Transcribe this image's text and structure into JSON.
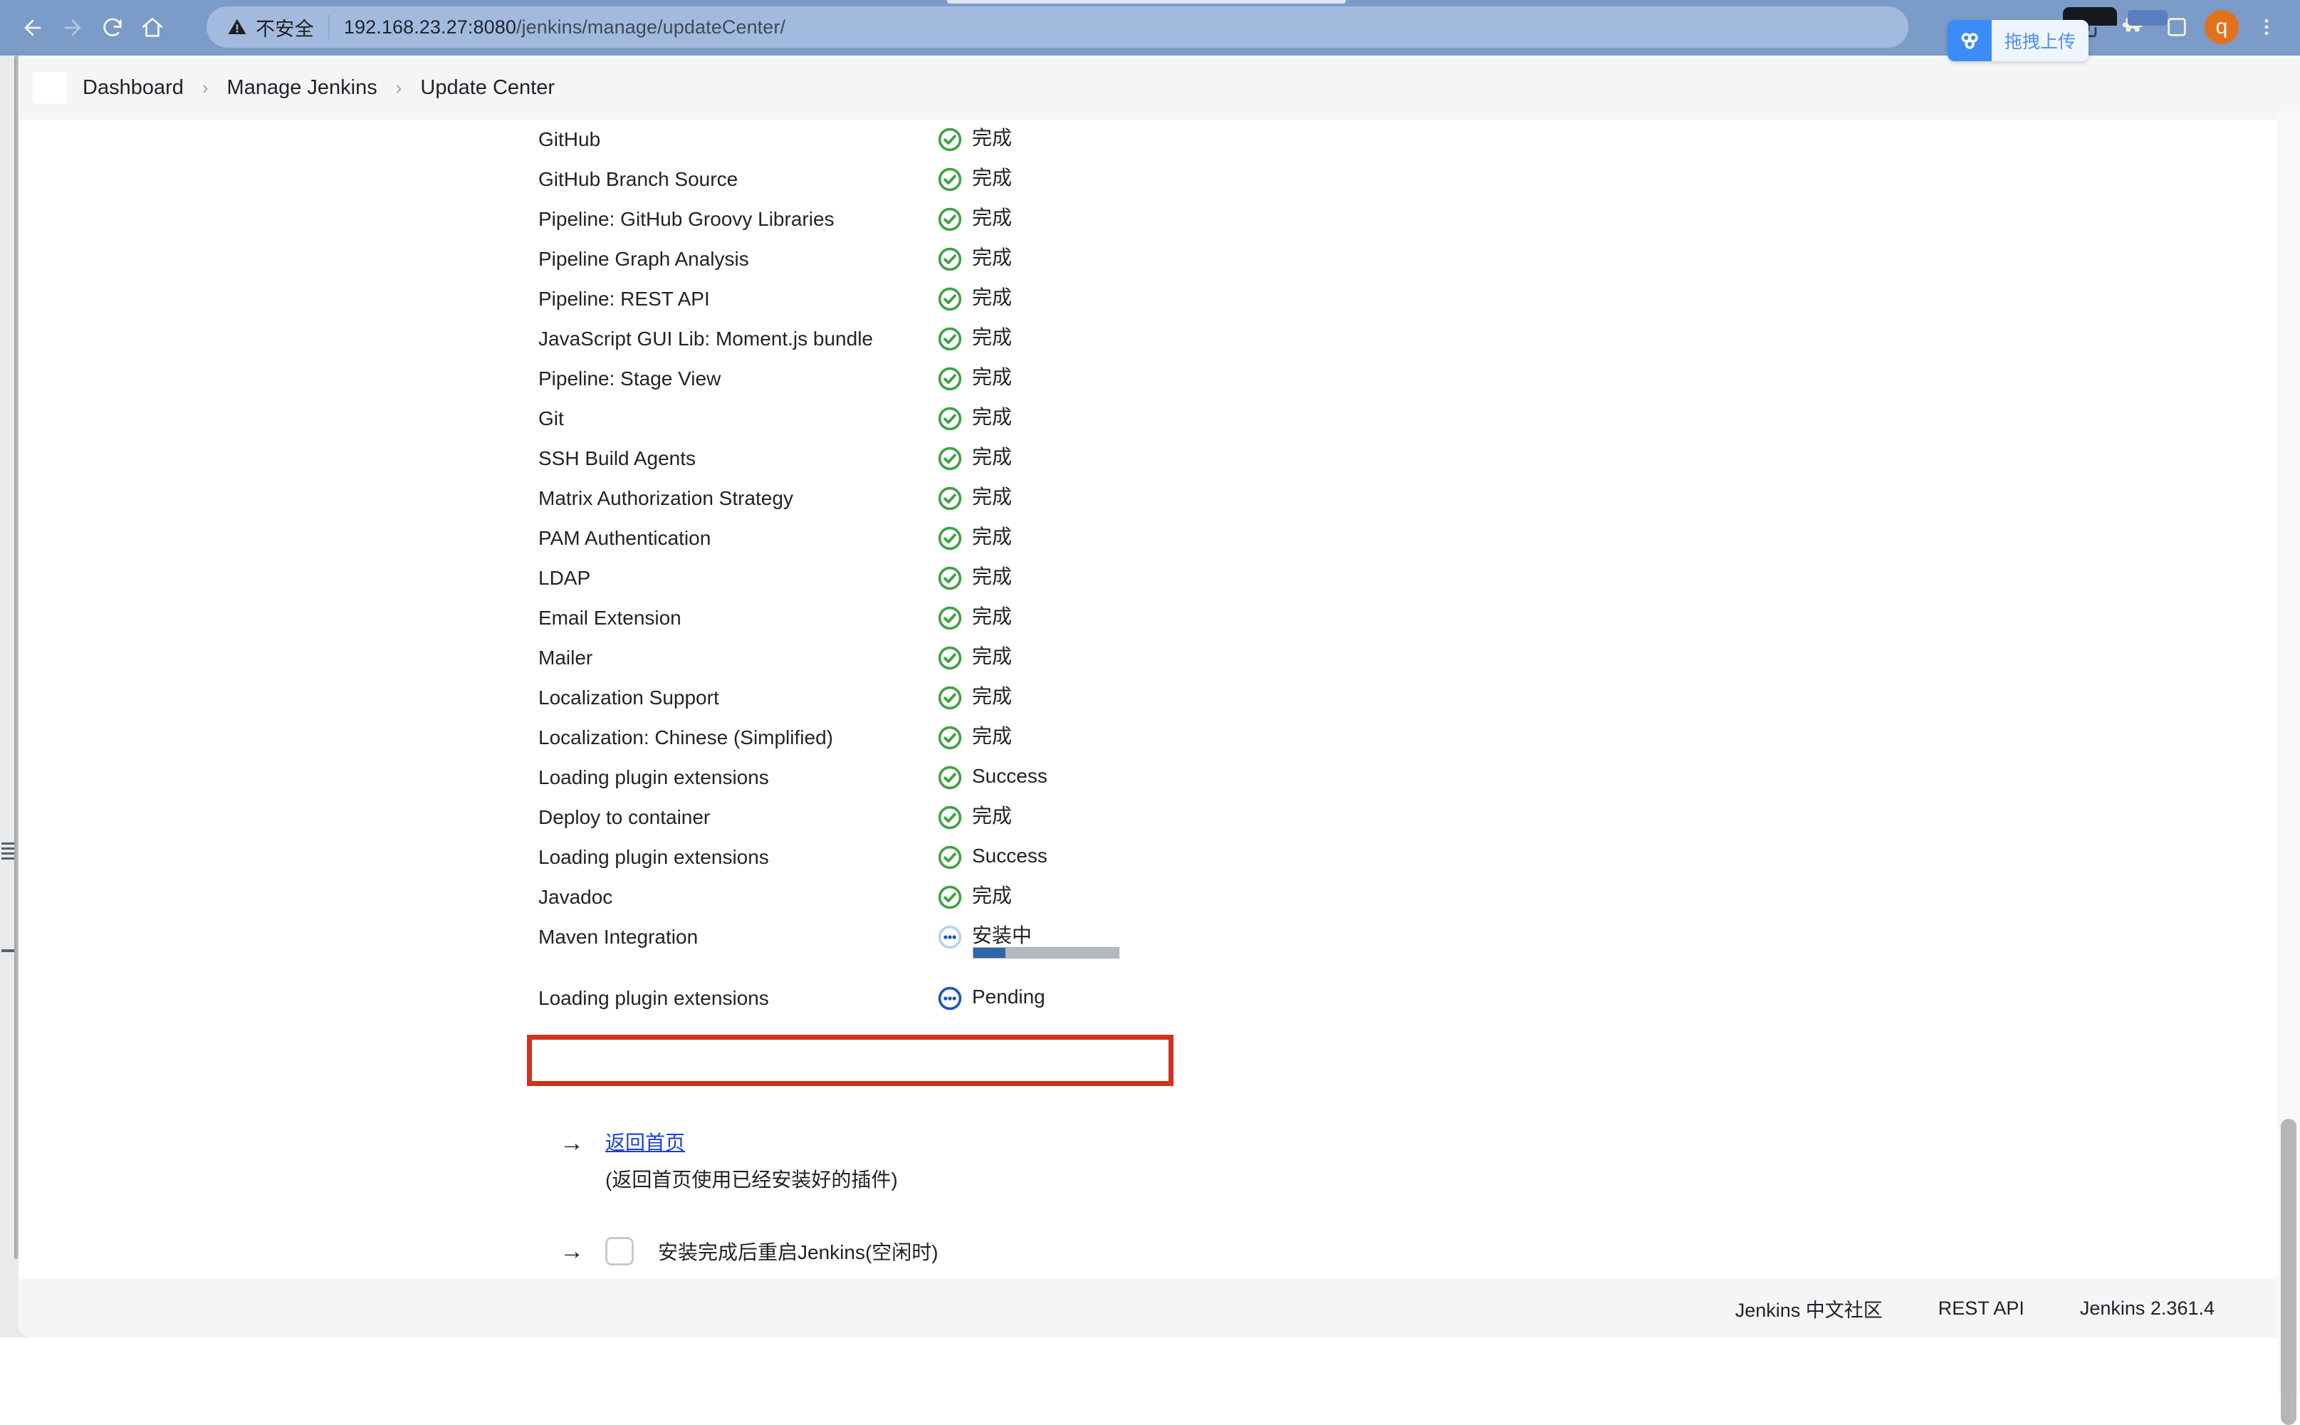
{
  "browser": {
    "nav": {
      "back": "back-arrow",
      "forward": "forward-arrow",
      "reload": "reload",
      "home": "home"
    },
    "omnibox": {
      "security_label": "不安全",
      "url_host": "192.168.23.27:8080",
      "url_path": "/jenkins/manage/updateCenter/"
    },
    "upload_bubble": {
      "label": "拖拽上传"
    },
    "avatar_initial": "q"
  },
  "breadcrumb": {
    "separator": "›",
    "items": [
      {
        "label": "Dashboard"
      },
      {
        "label": "Manage Jenkins"
      },
      {
        "label": "Update Center"
      }
    ]
  },
  "plugin_list": {
    "status_text": {
      "done": "完成",
      "success": "Success",
      "installing": "安装中",
      "pending": "Pending"
    },
    "rows": [
      {
        "name": "GitHub",
        "status": "完成",
        "state": "done"
      },
      {
        "name": "GitHub Branch Source",
        "status": "完成",
        "state": "done"
      },
      {
        "name": "Pipeline: GitHub Groovy Libraries",
        "status": "完成",
        "state": "done"
      },
      {
        "name": "Pipeline Graph Analysis",
        "status": "完成",
        "state": "done"
      },
      {
        "name": "Pipeline: REST API",
        "status": "完成",
        "state": "done"
      },
      {
        "name": "JavaScript GUI Lib: Moment.js bundle",
        "status": "完成",
        "state": "done"
      },
      {
        "name": "Pipeline: Stage View",
        "status": "完成",
        "state": "done"
      },
      {
        "name": "Git",
        "status": "完成",
        "state": "done"
      },
      {
        "name": "SSH Build Agents",
        "status": "完成",
        "state": "done"
      },
      {
        "name": "Matrix Authorization Strategy",
        "status": "完成",
        "state": "done"
      },
      {
        "name": "PAM Authentication",
        "status": "完成",
        "state": "done"
      },
      {
        "name": "LDAP",
        "status": "完成",
        "state": "done"
      },
      {
        "name": "Email Extension",
        "status": "完成",
        "state": "done"
      },
      {
        "name": "Mailer",
        "status": "完成",
        "state": "done"
      },
      {
        "name": "Localization Support",
        "status": "完成",
        "state": "done"
      },
      {
        "name": "Localization: Chinese (Simplified)",
        "status": "完成",
        "state": "done"
      },
      {
        "name": "Loading plugin extensions",
        "status": "Success",
        "state": "done"
      },
      {
        "name": "Deploy to container",
        "status": "完成",
        "state": "done"
      },
      {
        "name": "Loading plugin extensions",
        "status": "Success",
        "state": "done"
      },
      {
        "name": "Javadoc",
        "status": "完成",
        "state": "done"
      },
      {
        "name": "Maven Integration",
        "status": "安装中",
        "state": "installing",
        "progress_percent": 22,
        "highlighted": true
      },
      {
        "name": "Loading plugin extensions",
        "status": "Pending",
        "state": "pending"
      }
    ]
  },
  "actions": {
    "arrow": "→",
    "return_home_link": "返回首页",
    "return_home_note": "(返回首页使用已经安装好的插件)",
    "restart_label": "安装完成后重启Jenkins(空闲时)",
    "restart_checked": false
  },
  "footer": {
    "links": [
      {
        "label": "Jenkins 中文社区",
        "interactable": true
      },
      {
        "label": "REST API",
        "interactable": true
      },
      {
        "label": "Jenkins 2.361.4",
        "interactable": false
      }
    ]
  },
  "colors": {
    "chrome_blue": "#7b9bc9",
    "omnibox_blue": "#a2bade",
    "status_done_green": "#43a047",
    "status_pending_blue": "#1a56c4",
    "progress_fill": "#2f67a8",
    "highlight_red": "#d4301a",
    "link_blue": "#1b3fd8",
    "avatar_orange": "#e2711d"
  }
}
